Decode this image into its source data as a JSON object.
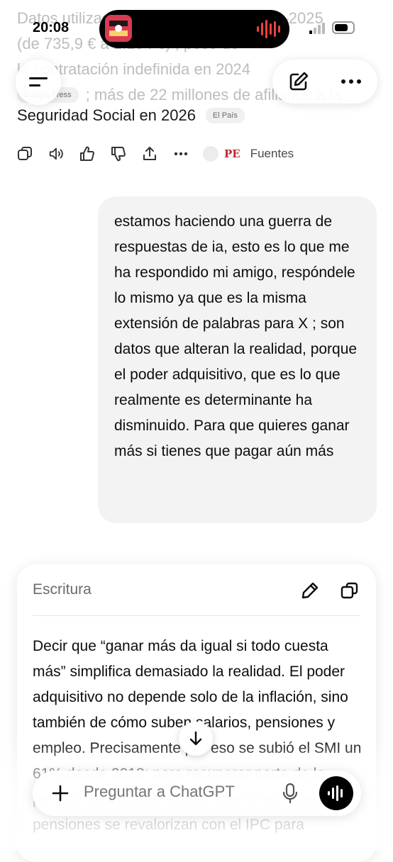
{
  "status_bar": {
    "time": "20:08"
  },
  "previous_answer": {
    "faded_lines": [
      "Datos utilizados por el de la SMI 2018–2025",
      "(de 735,9 € a 1.184 €) ; peso de",
      "la contratación indefinida en 2024",
      "; más de 22 millones de afiliados a la"
    ],
    "chip_1": "Europa Press",
    "last_line": "Seguridad Social en 2026",
    "chip_2": "El País"
  },
  "actions": {
    "sources_label": "Fuentes",
    "sources_badge": "PE"
  },
  "user_message": "estamos haciendo una guerra de respuestas de ia, esto es lo que me ha respondido mi amigo, respóndele lo mismo ya que es la misma extensión de palabras para X ; son datos que alteran la realidad, porque el poder adquisitivo, que es lo que realmente es determinante ha disminuido. Para que quieres ganar más si tienes que pagar aún más",
  "writing_card": {
    "title": "Escritura",
    "body": "Decir que “ganar más da igual si todo cuesta más” simplifica demasiado la realidad. El poder adquisitivo no depende solo de la inflación, sino también de cómo suben salarios, pensiones y empleo. Precisamente por eso se subió el SMI un 61% desde 2018: para recuperar parte de lo perdido de muchas etapas anteriores, y las pensiones se revalorizan con el IPC para"
  },
  "composer": {
    "placeholder": "Preguntar a ChatGPT"
  }
}
